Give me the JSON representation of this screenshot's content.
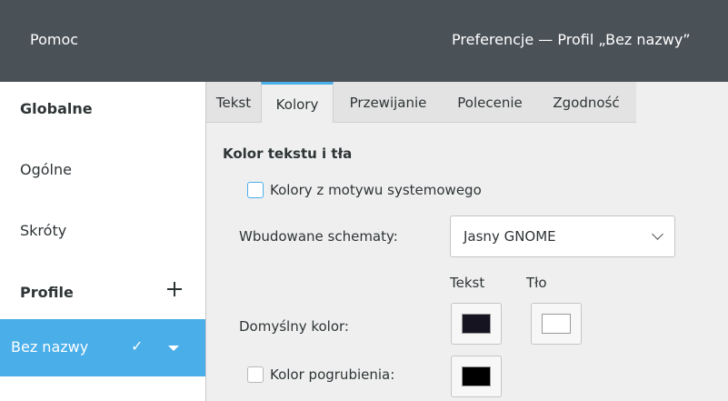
{
  "titlebar": {
    "menu_help": "Pomoc",
    "window_title": "Preferencje — Profil „Bez nazwy”"
  },
  "sidebar": {
    "global_header": "Globalne",
    "items": [
      {
        "label": "Ogólne"
      },
      {
        "label": "Skróty"
      }
    ],
    "profiles_header": "Profile",
    "add_icon": "plus-icon",
    "profile": {
      "name": "Bez nazwy",
      "check_icon": "checkmark-icon",
      "menu_icon": "arrow-down-icon"
    }
  },
  "tabs": [
    {
      "label": "Tekst"
    },
    {
      "label": "Kolory",
      "active": true
    },
    {
      "label": "Przewijanie"
    },
    {
      "label": "Polecenie"
    },
    {
      "label": "Zgodność"
    }
  ],
  "colors_tab": {
    "section_title": "Kolor tekstu i tła",
    "system_theme_checkbox_label": "Kolory z motywu systemowego",
    "system_theme_checked": false,
    "builtin_schemes_label": "Wbudowane schematy:",
    "builtin_schemes_value": "Jasny GNOME",
    "column_text": "Tekst",
    "column_background": "Tło",
    "default_color_label": "Domyślny kolor:",
    "default_text_color": "#171421",
    "default_background_color": "#ffffff",
    "bold_color_checkbox_label": "Kolor pogrubienia:",
    "bold_color_checked": false,
    "bold_color": "#000000"
  },
  "accent_color": "#4aaee8"
}
